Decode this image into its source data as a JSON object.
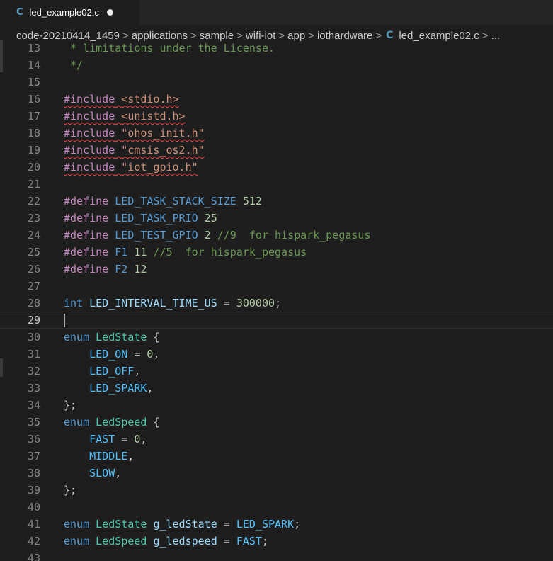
{
  "tab": {
    "icon": "C",
    "icon_name": "c-language-icon",
    "label": "led_example02.c",
    "dirty": true
  },
  "breadcrumb": {
    "items": [
      "code-20210414_1459",
      "applications",
      "sample",
      "wifi-iot",
      "app",
      "iothardware"
    ],
    "file_icon": "C",
    "file": "led_example02.c",
    "ellipsis": "..."
  },
  "colors": {
    "background": "#1e1e1e",
    "comment": "#6a9955",
    "preprocessor": "#c586c0",
    "string": "#ce9178",
    "keyword": "#569cd6",
    "type": "#4ec9b0",
    "number": "#b5cea8",
    "variable": "#9cdcfe",
    "error": "#f14c4c"
  },
  "editor": {
    "current_line": 29,
    "lines": [
      {
        "n": "13",
        "tokens": [
          {
            "t": " * limitations under the License.",
            "c": "cm"
          }
        ]
      },
      {
        "n": "14",
        "tokens": [
          {
            "t": " */",
            "c": "cm"
          }
        ]
      },
      {
        "n": "15",
        "tokens": []
      },
      {
        "n": "16",
        "tokens": [
          {
            "t": "#include",
            "c": "pp",
            "sq": true
          },
          {
            "t": " ",
            "sq": true
          },
          {
            "t": "<stdio.h>",
            "c": "str",
            "sq": true
          }
        ]
      },
      {
        "n": "17",
        "tokens": [
          {
            "t": "#include",
            "c": "pp",
            "sq": true
          },
          {
            "t": " ",
            "sq": true
          },
          {
            "t": "<unistd.h>",
            "c": "str",
            "sq": true
          }
        ]
      },
      {
        "n": "18",
        "tokens": [
          {
            "t": "#include",
            "c": "pp",
            "sq": true
          },
          {
            "t": " ",
            "sq": true
          },
          {
            "t": "\"ohos_init.h\"",
            "c": "str",
            "sq": true
          }
        ]
      },
      {
        "n": "19",
        "tokens": [
          {
            "t": "#include",
            "c": "pp",
            "sq": true
          },
          {
            "t": " ",
            "sq": true
          },
          {
            "t": "\"cmsis_os2.h\"",
            "c": "str",
            "sq": true
          }
        ]
      },
      {
        "n": "20",
        "tokens": [
          {
            "t": "#include",
            "c": "pp",
            "sq": true
          },
          {
            "t": " ",
            "sq": true
          },
          {
            "t": "\"iot_gpio.h\"",
            "c": "str",
            "sq": true
          }
        ]
      },
      {
        "n": "21",
        "tokens": []
      },
      {
        "n": "22",
        "tokens": [
          {
            "t": "#define",
            "c": "pp"
          },
          {
            "t": " "
          },
          {
            "t": "LED_TASK_STACK_SIZE",
            "c": "mac"
          },
          {
            "t": " "
          },
          {
            "t": "512",
            "c": "num"
          }
        ]
      },
      {
        "n": "23",
        "tokens": [
          {
            "t": "#define",
            "c": "pp"
          },
          {
            "t": " "
          },
          {
            "t": "LED_TASK_PRIO",
            "c": "mac"
          },
          {
            "t": " "
          },
          {
            "t": "25",
            "c": "num"
          }
        ]
      },
      {
        "n": "24",
        "tokens": [
          {
            "t": "#define",
            "c": "pp"
          },
          {
            "t": " "
          },
          {
            "t": "LED_TEST_GPIO",
            "c": "mac"
          },
          {
            "t": " "
          },
          {
            "t": "2",
            "c": "num"
          },
          {
            "t": " "
          },
          {
            "t": "//9  for hispark_pegasus",
            "c": "cm"
          }
        ]
      },
      {
        "n": "25",
        "tokens": [
          {
            "t": "#define",
            "c": "pp"
          },
          {
            "t": " "
          },
          {
            "t": "F1",
            "c": "mac"
          },
          {
            "t": " "
          },
          {
            "t": "11",
            "c": "num"
          },
          {
            "t": " "
          },
          {
            "t": "//5  for hispark_pegasus",
            "c": "cm"
          }
        ]
      },
      {
        "n": "26",
        "tokens": [
          {
            "t": "#define",
            "c": "pp"
          },
          {
            "t": " "
          },
          {
            "t": "F2",
            "c": "mac"
          },
          {
            "t": " "
          },
          {
            "t": "12",
            "c": "num"
          }
        ]
      },
      {
        "n": "27",
        "tokens": []
      },
      {
        "n": "28",
        "tokens": [
          {
            "t": "int",
            "c": "kw"
          },
          {
            "t": " "
          },
          {
            "t": "LED_INTERVAL_TIME_US",
            "c": "var"
          },
          {
            "t": " = "
          },
          {
            "t": "300000",
            "c": "num"
          },
          {
            "t": ";"
          }
        ]
      },
      {
        "n": "29",
        "tokens": []
      },
      {
        "n": "30",
        "tokens": [
          {
            "t": "enum",
            "c": "kw"
          },
          {
            "t": " "
          },
          {
            "t": "LedState",
            "c": "ty"
          },
          {
            "t": " {"
          }
        ]
      },
      {
        "n": "31",
        "tokens": [
          {
            "t": "    "
          },
          {
            "t": "LED_ON",
            "c": "en"
          },
          {
            "t": " = "
          },
          {
            "t": "0",
            "c": "num"
          },
          {
            "t": ","
          }
        ]
      },
      {
        "n": "32",
        "tokens": [
          {
            "t": "    "
          },
          {
            "t": "LED_OFF",
            "c": "en"
          },
          {
            "t": ","
          }
        ]
      },
      {
        "n": "33",
        "tokens": [
          {
            "t": "    "
          },
          {
            "t": "LED_SPARK",
            "c": "en"
          },
          {
            "t": ","
          }
        ]
      },
      {
        "n": "34",
        "tokens": [
          {
            "t": "};"
          }
        ]
      },
      {
        "n": "35",
        "tokens": [
          {
            "t": "enum",
            "c": "kw"
          },
          {
            "t": " "
          },
          {
            "t": "LedSpeed",
            "c": "ty"
          },
          {
            "t": " {"
          }
        ]
      },
      {
        "n": "36",
        "tokens": [
          {
            "t": "    "
          },
          {
            "t": "FAST",
            "c": "en"
          },
          {
            "t": " = "
          },
          {
            "t": "0",
            "c": "num"
          },
          {
            "t": ","
          }
        ]
      },
      {
        "n": "37",
        "tokens": [
          {
            "t": "    "
          },
          {
            "t": "MIDDLE",
            "c": "en"
          },
          {
            "t": ","
          }
        ]
      },
      {
        "n": "38",
        "tokens": [
          {
            "t": "    "
          },
          {
            "t": "SLOW",
            "c": "en"
          },
          {
            "t": ","
          }
        ]
      },
      {
        "n": "39",
        "tokens": [
          {
            "t": "};"
          }
        ]
      },
      {
        "n": "40",
        "tokens": []
      },
      {
        "n": "41",
        "tokens": [
          {
            "t": "enum",
            "c": "kw"
          },
          {
            "t": " "
          },
          {
            "t": "LedState",
            "c": "ty"
          },
          {
            "t": " "
          },
          {
            "t": "g_ledState",
            "c": "var"
          },
          {
            "t": " = "
          },
          {
            "t": "LED_SPARK",
            "c": "en"
          },
          {
            "t": ";"
          }
        ]
      },
      {
        "n": "42",
        "tokens": [
          {
            "t": "enum",
            "c": "kw"
          },
          {
            "t": " "
          },
          {
            "t": "LedSpeed",
            "c": "ty"
          },
          {
            "t": " "
          },
          {
            "t": "g_ledspeed",
            "c": "var"
          },
          {
            "t": " = "
          },
          {
            "t": "FAST",
            "c": "en"
          },
          {
            "t": ";"
          }
        ]
      },
      {
        "n": "43",
        "tokens": []
      }
    ]
  }
}
